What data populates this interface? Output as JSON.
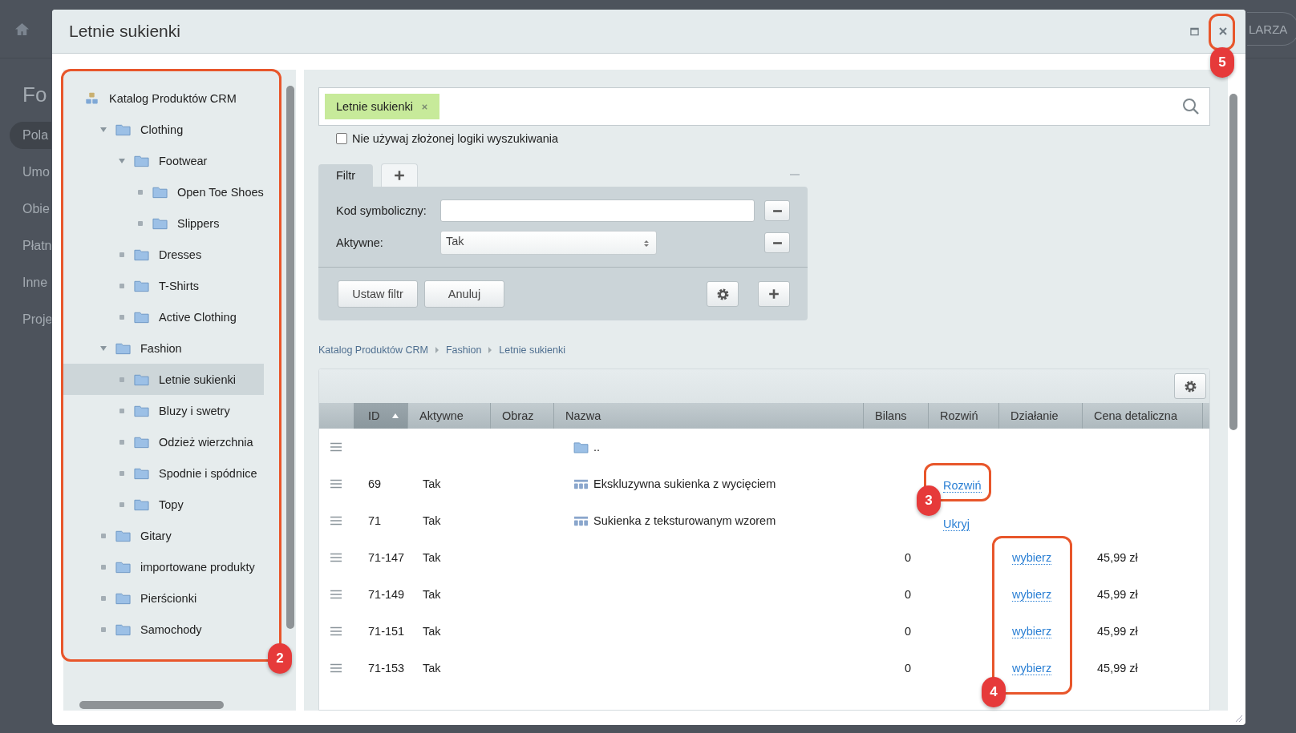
{
  "background": {
    "heading": "Fo",
    "menu": [
      {
        "label": "Pola",
        "selected": true
      },
      {
        "label": "Umo",
        "selected": false
      },
      {
        "label": "Obie",
        "selected": false
      },
      {
        "label": "Płatn",
        "selected": false
      },
      {
        "label": "Inne",
        "selected": false
      },
      {
        "label": "Proje",
        "selected": false
      }
    ],
    "top_button": "LARZA"
  },
  "window": {
    "title": "Letnie sukienki"
  },
  "tree": {
    "label": "Katalog Produktów CRM",
    "kind": "catalog",
    "selected": false,
    "children": [
      {
        "label": "Clothing",
        "kind": "folder",
        "selected": false,
        "expanded": true,
        "children": [
          {
            "label": "Footwear",
            "kind": "folder",
            "selected": false,
            "expanded": true,
            "children": [
              {
                "label": "Open Toe Shoes",
                "kind": "folder",
                "selected": false
              },
              {
                "label": "Slippers",
                "kind": "folder",
                "selected": false
              }
            ]
          },
          {
            "label": "Dresses",
            "kind": "folder",
            "selected": false
          },
          {
            "label": "T-Shirts",
            "kind": "folder",
            "selected": false
          },
          {
            "label": "Active Clothing",
            "kind": "folder",
            "selected": false
          }
        ]
      },
      {
        "label": "Fashion",
        "kind": "folder",
        "selected": false,
        "expanded": true,
        "children": [
          {
            "label": "Letnie sukienki",
            "kind": "folder",
            "selected": true
          },
          {
            "label": "Bluzy i swetry",
            "kind": "folder",
            "selected": false
          },
          {
            "label": "Odzież wierzchnia",
            "kind": "folder",
            "selected": false
          },
          {
            "label": "Spodnie i spódnice",
            "kind": "folder",
            "selected": false
          },
          {
            "label": "Topy",
            "kind": "folder",
            "selected": false
          }
        ]
      },
      {
        "label": "Gitary",
        "kind": "folder",
        "selected": false
      },
      {
        "label": "importowane produkty",
        "kind": "folder",
        "selected": false
      },
      {
        "label": "Pierścionki",
        "kind": "folder",
        "selected": false
      },
      {
        "label": "Samochody",
        "kind": "folder",
        "selected": false
      }
    ]
  },
  "search": {
    "tag": "Letnie sukienki",
    "option": {
      "label": "Nie używaj złożonej logiki wyszukiwania",
      "checked": false
    }
  },
  "filter": {
    "tab": {
      "label": "Filtr",
      "selected": true
    },
    "fields": [
      {
        "kind": "text",
        "label": "Kod symboliczny:"
      },
      {
        "kind": "select",
        "label": "Aktywne:",
        "value": "Tak"
      }
    ],
    "buttons": [
      "Ustaw filtr",
      "Anuluj"
    ]
  },
  "breadcrumb": [
    "Katalog Produktów CRM",
    "Fashion",
    "Letnie sukienki"
  ],
  "table": {
    "columns": [
      {
        "label": "ID",
        "sorted": true
      },
      {
        "label": "Aktywne",
        "sorted": false
      },
      {
        "label": "Obraz",
        "sorted": false
      },
      {
        "label": "Nazwa",
        "sorted": false
      },
      {
        "label": "Bilans",
        "sorted": false
      },
      {
        "label": "Rozwiń",
        "sorted": false
      },
      {
        "label": "Działanie",
        "sorted": false
      },
      {
        "label": "Cena detaliczna",
        "sorted": false
      }
    ],
    "rows": [
      {
        "id": "",
        "active": "",
        "kind": "folder",
        "name": "..",
        "balance": "",
        "expand": "",
        "action": "",
        "price": ""
      },
      {
        "id": "69",
        "active": "Tak",
        "kind": "product",
        "name": "Ekskluzywna sukienka z wycięciem",
        "balance": "",
        "expand": "Rozwiń",
        "action": "",
        "price": ""
      },
      {
        "id": "71",
        "active": "Tak",
        "kind": "product",
        "name": "Sukienka z teksturowanym wzorem",
        "balance": "",
        "expand": "Ukryj",
        "action": "",
        "price": ""
      },
      {
        "id": "71-147",
        "active": "Tak",
        "kind": "none",
        "name": "",
        "balance": "0",
        "expand": "",
        "action": "wybierz",
        "price": "45,99 zł"
      },
      {
        "id": "71-149",
        "active": "Tak",
        "kind": "none",
        "name": "",
        "balance": "0",
        "expand": "",
        "action": "wybierz",
        "price": "45,99 zł"
      },
      {
        "id": "71-151",
        "active": "Tak",
        "kind": "none",
        "name": "",
        "balance": "0",
        "expand": "",
        "action": "wybierz",
        "price": "45,99 zł"
      },
      {
        "id": "71-153",
        "active": "Tak",
        "kind": "none",
        "name": "",
        "balance": "0",
        "expand": "",
        "action": "wybierz",
        "price": "45,99 zł"
      }
    ]
  },
  "callouts": [
    {
      "number": "2"
    },
    {
      "number": "3"
    },
    {
      "number": "4"
    },
    {
      "number": "5"
    }
  ]
}
